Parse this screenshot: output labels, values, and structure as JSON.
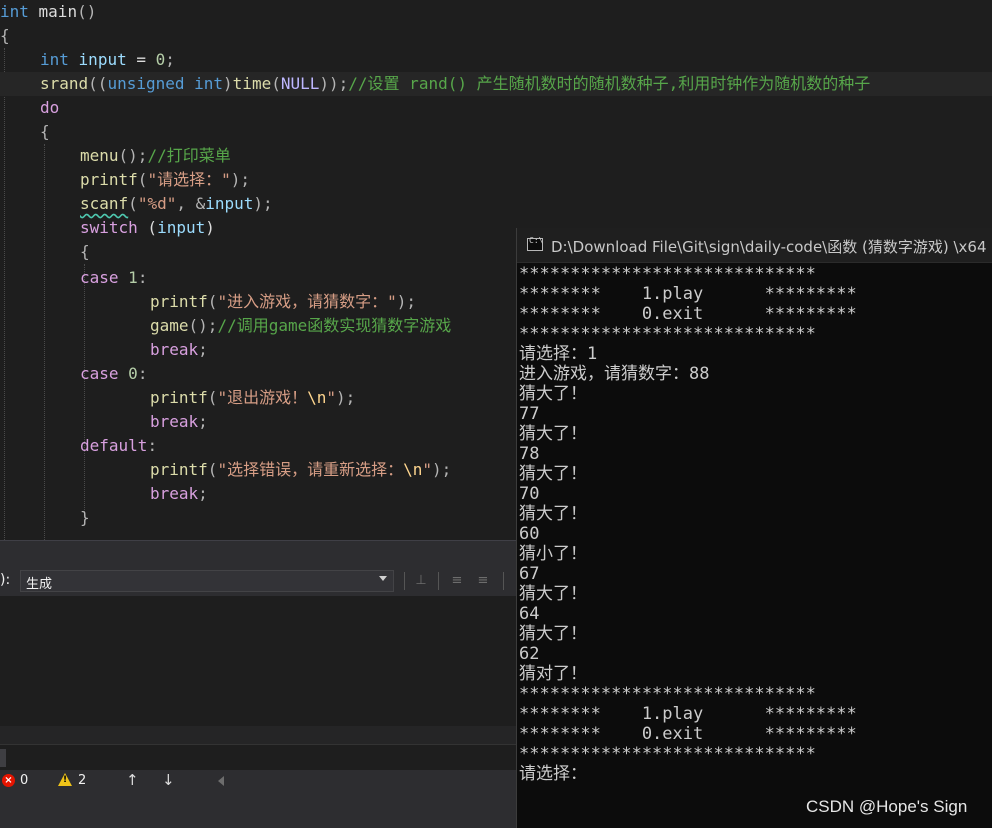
{
  "editor": {
    "lines": [
      {
        "tokens": [
          [
            "kw",
            "int"
          ],
          [
            "plain",
            " main"
          ],
          [
            "pun",
            "()"
          ]
        ]
      },
      {
        "tokens": [
          [
            "pun",
            "{"
          ]
        ]
      },
      {
        "tokens": [
          [
            "kw",
            "int"
          ],
          [
            "plain",
            " "
          ],
          [
            "var",
            "input"
          ],
          [
            "plain",
            " = "
          ],
          [
            "num",
            "0"
          ],
          [
            "pun",
            ";"
          ]
        ]
      },
      {
        "tokens": [
          [
            "fn",
            "srand"
          ],
          [
            "pun",
            "(("
          ],
          [
            "kw",
            "unsigned int"
          ],
          [
            "pun",
            ")"
          ],
          [
            "fn",
            "time"
          ],
          [
            "pun",
            "("
          ],
          [
            "mac",
            "NULL"
          ],
          [
            "pun",
            "));"
          ],
          [
            "cmt",
            "//设置 rand() 产生随机数时的随机数种子,利用时钟作为随机数的种子"
          ]
        ]
      },
      {
        "tokens": [
          [
            "ctl",
            "do"
          ]
        ]
      },
      {
        "tokens": [
          [
            "pun",
            "{"
          ]
        ]
      },
      {
        "tokens": [
          [
            "fn",
            "menu"
          ],
          [
            "pun",
            "();"
          ],
          [
            "cmt",
            "//打印菜单"
          ]
        ]
      },
      {
        "tokens": [
          [
            "fn",
            "printf"
          ],
          [
            "pun",
            "("
          ],
          [
            "str",
            "\"请选择：\""
          ],
          [
            "pun",
            ");"
          ]
        ]
      },
      {
        "tokens": [
          [
            "fnsq",
            "scanf"
          ],
          [
            "pun",
            "("
          ],
          [
            "str",
            "\"%d\""
          ],
          [
            "pun",
            ", &"
          ],
          [
            "var",
            "input"
          ],
          [
            "pun",
            ");"
          ]
        ]
      },
      {
        "tokens": [
          [
            "ctl",
            "switch"
          ],
          [
            "plain",
            " ("
          ],
          [
            "var",
            "input"
          ],
          [
            "plain",
            ")"
          ]
        ]
      },
      {
        "tokens": [
          [
            "pun",
            "{"
          ]
        ]
      },
      {
        "tokens": [
          [
            "ctl",
            "case"
          ],
          [
            "plain",
            " "
          ],
          [
            "num",
            "1"
          ],
          [
            "pun",
            ":"
          ]
        ]
      },
      {
        "tokens": [
          [
            "fn",
            "printf"
          ],
          [
            "pun",
            "("
          ],
          [
            "str",
            "\"进入游戏，请猜数字：\""
          ],
          [
            "pun",
            ");"
          ]
        ]
      },
      {
        "tokens": [
          [
            "fn",
            "game"
          ],
          [
            "pun",
            "();"
          ],
          [
            "cmt",
            "//调用game函数实现猜数字游戏"
          ]
        ]
      },
      {
        "tokens": [
          [
            "ctl",
            "break"
          ],
          [
            "pun",
            ";"
          ]
        ]
      },
      {
        "tokens": [
          [
            "ctl",
            "case"
          ],
          [
            "plain",
            " "
          ],
          [
            "num",
            "0"
          ],
          [
            "pun",
            ":"
          ]
        ]
      },
      {
        "tokens": [
          [
            "fn",
            "printf"
          ],
          [
            "pun",
            "("
          ],
          [
            "str",
            "\"退出游戏！"
          ],
          [
            "esc",
            "\\n"
          ],
          [
            "str",
            "\""
          ],
          [
            "pun",
            ");"
          ]
        ]
      },
      {
        "tokens": [
          [
            "ctl",
            "break"
          ],
          [
            "pun",
            ";"
          ]
        ]
      },
      {
        "tokens": [
          [
            "ctl",
            "default"
          ],
          [
            "pun",
            ":"
          ]
        ]
      },
      {
        "tokens": [
          [
            "fn",
            "printf"
          ],
          [
            "pun",
            "("
          ],
          [
            "str",
            "\"选择错误，请重新选择："
          ],
          [
            "esc",
            "\\n"
          ],
          [
            "str",
            "\""
          ],
          [
            "pun",
            ");"
          ]
        ]
      },
      {
        "tokens": [
          [
            "ctl",
            "break"
          ],
          [
            "pun",
            ";"
          ]
        ]
      },
      {
        "tokens": [
          [
            "pun",
            "}"
          ]
        ]
      }
    ]
  },
  "output_panel": {
    "source_label": "):",
    "source_value": "生成"
  },
  "status": {
    "errors": "0",
    "warnings": "2",
    "up_arrow": "↑",
    "down_arrow": "↓"
  },
  "console": {
    "icon_text": "C:\\",
    "title": "D:\\Download File\\Git\\sign\\daily-code\\函数 (猜数字游戏) \\x64",
    "lines": [
      "*****************************",
      "********    1.play      *********",
      "********    0.exit      *********",
      "*****************************",
      "请选择：1",
      "进入游戏，请猜数字：88",
      "猜大了！",
      "77",
      "猜大了！",
      "78",
      "猜大了！",
      "70",
      "猜大了！",
      "60",
      "猜小了！",
      "67",
      "猜大了！",
      "64",
      "猜大了！",
      "62",
      "猜对了！",
      "*****************************",
      "********    1.play      *********",
      "********    0.exit      *********",
      "*****************************",
      "请选择："
    ]
  },
  "watermark": "CSDN @Hope's Sign",
  "colors": {
    "editor_bg": "#1e1e1e",
    "keyword": "#569cd6",
    "control": "#d8a0df",
    "function": "#dcdcaa",
    "variable": "#9cdcfe",
    "string": "#d69d85",
    "comment": "#57a64a",
    "console_bg": "#0c0c0c",
    "console_text": "#cccccc"
  }
}
